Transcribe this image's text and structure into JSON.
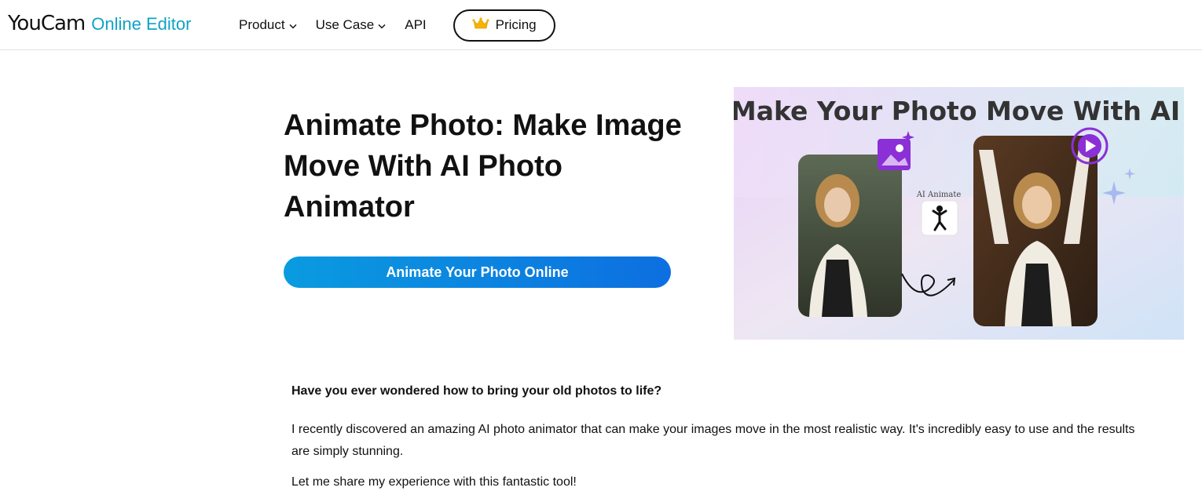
{
  "header": {
    "logo_brand": "YouCam",
    "logo_sub": "Online Editor",
    "nav": {
      "product": "Product",
      "use_case": "Use Case",
      "api": "API",
      "pricing": "Pricing"
    }
  },
  "hero": {
    "title": "Animate Photo: Make Image Move With AI Photo Animator",
    "cta_label": "Animate Your Photo Online",
    "image": {
      "headline": "Make Your Photo Move With AI",
      "badge_label": "AI Animate"
    }
  },
  "content": {
    "question": "Have you ever wondered how to bring your old photos to life?",
    "paragraph1": "I recently discovered an amazing AI photo animator that can make your images move in the most realistic way. It's incredibly easy to use and the results are simply stunning.",
    "paragraph2": "Let me share my experience with this fantastic tool!"
  },
  "colors": {
    "brand_accent": "#0fa3c7",
    "cta_start": "#0a9be0",
    "cta_end": "#0d6fe0",
    "icon_purple": "#8b2fd6"
  }
}
